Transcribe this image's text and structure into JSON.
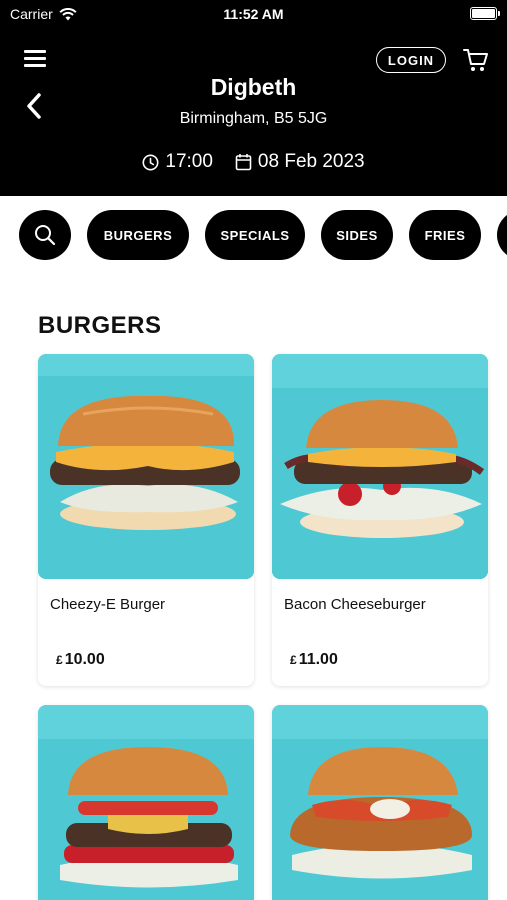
{
  "status_bar": {
    "carrier": "Carrier",
    "time": "11:52 AM"
  },
  "header": {
    "login_label": "LOGIN",
    "store_name": "Digbeth",
    "store_address": "Birmingham, B5 5JG",
    "time": "17:00",
    "date": "08 Feb 2023"
  },
  "categories": {
    "items": [
      "BURGERS",
      "SPECIALS",
      "SIDES",
      "FRIES"
    ]
  },
  "section": {
    "title": "BURGERS"
  },
  "products": [
    {
      "name": "Cheezy-E Burger",
      "currency": "£",
      "price": "10.00"
    },
    {
      "name": "Bacon Cheeseburger",
      "currency": "£",
      "price": "11.00"
    },
    {
      "name": "",
      "currency": "",
      "price": ""
    },
    {
      "name": "",
      "currency": "",
      "price": ""
    }
  ],
  "colors": {
    "header_bg": "#000000",
    "photo_bg": "#4ec9d3",
    "chip_bg": "#000000"
  }
}
